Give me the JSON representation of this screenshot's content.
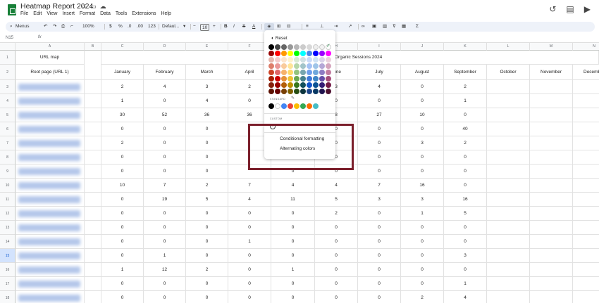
{
  "document": {
    "title": "Heatmap Report 2024",
    "menu": [
      "File",
      "Edit",
      "View",
      "Insert",
      "Format",
      "Data",
      "Tools",
      "Extensions",
      "Help"
    ]
  },
  "toolbar": {
    "menus_label": "Menus",
    "zoom": "100%",
    "currency": "$",
    "percent": "%",
    "decimal_decrease": ".0",
    "decimal_increase": ".00",
    "number_format": "123",
    "font": "Defaul...",
    "font_size": "10",
    "bold": "B",
    "italic": "I",
    "strikethrough": "S",
    "text_color": "A",
    "function": "Σ"
  },
  "formula_bar": {
    "name_box": "N15",
    "fx": "fx"
  },
  "columns": [
    "A",
    "B",
    "C",
    "D",
    "E",
    "F",
    "G",
    "H",
    "I",
    "J",
    "K",
    "L",
    "M",
    "N"
  ],
  "headers": {
    "url_map": "URL map",
    "root_page": "Root page (URL 1)",
    "organic_sessions": "Organic Sessions 2024",
    "months": [
      "January",
      "February",
      "March",
      "April",
      "May",
      "June",
      "July",
      "August",
      "September",
      "October",
      "November",
      "December"
    ]
  },
  "row_numbers": [
    "1",
    "2",
    "3",
    "4",
    "5",
    "6",
    "7",
    "8",
    "9",
    "10",
    "11",
    "12",
    "13",
    "14",
    "15",
    "16",
    "17",
    "18"
  ],
  "selected_row": "15",
  "rows": [
    [
      "2",
      "4",
      "3",
      "2",
      "",
      "3",
      "4",
      "0",
      "2"
    ],
    [
      "1",
      "0",
      "4",
      "0",
      "",
      "0",
      "0",
      "0",
      "1"
    ],
    [
      "30",
      "52",
      "36",
      "36",
      "",
      "8",
      "27",
      "10",
      "0"
    ],
    [
      "0",
      "0",
      "0",
      "",
      "",
      "0",
      "0",
      "0",
      "40"
    ],
    [
      "2",
      "0",
      "0",
      "",
      "",
      "0",
      "0",
      "3",
      "2"
    ],
    [
      "0",
      "0",
      "0",
      "",
      "",
      "0",
      "0",
      "0",
      "0"
    ],
    [
      "0",
      "0",
      "0",
      "",
      "0",
      "0",
      "0",
      "0",
      "0"
    ],
    [
      "10",
      "7",
      "2",
      "7",
      "4",
      "4",
      "7",
      "16",
      "0"
    ],
    [
      "0",
      "19",
      "5",
      "4",
      "11",
      "5",
      "3",
      "3",
      "16"
    ],
    [
      "0",
      "0",
      "0",
      "0",
      "0",
      "2",
      "0",
      "1",
      "5"
    ],
    [
      "0",
      "0",
      "0",
      "0",
      "0",
      "0",
      "0",
      "0",
      "0"
    ],
    [
      "0",
      "0",
      "0",
      "1",
      "0",
      "0",
      "0",
      "0",
      "0"
    ],
    [
      "0",
      "1",
      "0",
      "0",
      "0",
      "0",
      "0",
      "0",
      "3"
    ],
    [
      "1",
      "12",
      "2",
      "0",
      "1",
      "0",
      "0",
      "0",
      "0"
    ],
    [
      "0",
      "0",
      "0",
      "0",
      "0",
      "0",
      "0",
      "0",
      "1"
    ],
    [
      "0",
      "0",
      "0",
      "0",
      "0",
      "0",
      "0",
      "2",
      "4"
    ]
  ],
  "color_picker": {
    "reset": "Reset",
    "standard_label": "STANDARD",
    "custom_label": "CUSTOM",
    "custom_add": "+",
    "conditional_formatting": "Conditional formatting",
    "alternating_colors": "Alternating colors",
    "palette": [
      [
        "#000000",
        "#434343",
        "#666666",
        "#999999",
        "#b7b7b7",
        "#cccccc",
        "#d9d9d9",
        "#efefef",
        "#f3f3f3",
        "#ffffff"
      ],
      [
        "#980000",
        "#ff0000",
        "#ff9900",
        "#ffff00",
        "#00ff00",
        "#00ffff",
        "#4a86e8",
        "#0000ff",
        "#9900ff",
        "#ff00ff"
      ],
      [
        "#e6b8af",
        "#f4cccc",
        "#fce5cd",
        "#fff2cc",
        "#d9ead3",
        "#d0e0e3",
        "#c9daf8",
        "#cfe2f3",
        "#d9d2e9",
        "#ead1dc"
      ],
      [
        "#dd7e6b",
        "#ea9999",
        "#f9cb9c",
        "#ffe599",
        "#b6d7a8",
        "#a2c4c9",
        "#a4c2f4",
        "#9fc5e8",
        "#b4a7d6",
        "#d5a6bd"
      ],
      [
        "#cc4125",
        "#e06666",
        "#f6b26b",
        "#ffd966",
        "#93c47d",
        "#76a5af",
        "#6d9eeb",
        "#6fa8dc",
        "#8e7cc3",
        "#c27ba0"
      ],
      [
        "#a61c00",
        "#cc0000",
        "#e69138",
        "#f1c232",
        "#6aa84f",
        "#45818e",
        "#3c78d8",
        "#3d85c6",
        "#674ea7",
        "#a64d79"
      ],
      [
        "#85200c",
        "#990000",
        "#b45f06",
        "#bf9000",
        "#38761d",
        "#134f5c",
        "#1155cc",
        "#0b5394",
        "#351c75",
        "#741b47"
      ],
      [
        "#5b0f00",
        "#660000",
        "#783f04",
        "#7f6000",
        "#274e13",
        "#0c343d",
        "#1c4587",
        "#073763",
        "#20124d",
        "#4c1130"
      ]
    ],
    "standard_colors": [
      "#000000",
      "#ffffff",
      "#4285f4",
      "#ea4335",
      "#fbbc04",
      "#34a853",
      "#ff6d01",
      "#46bdc6"
    ],
    "highlight_color": "#7b1f2b"
  }
}
